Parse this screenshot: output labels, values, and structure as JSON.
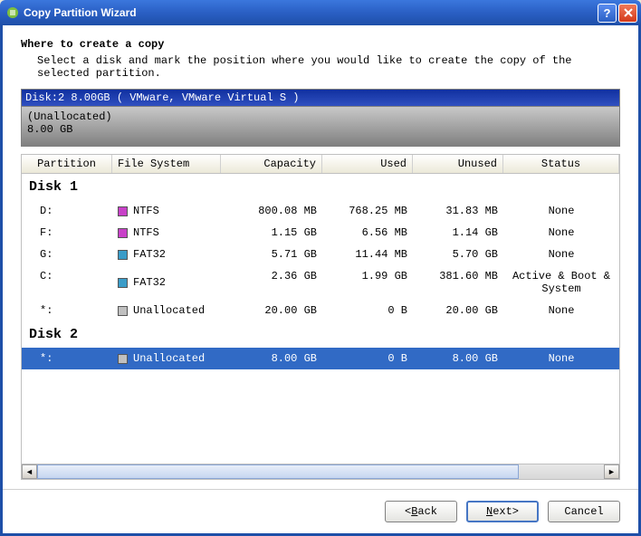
{
  "window": {
    "title": "Copy Partition Wizard"
  },
  "header": {
    "title": "Where to create a copy",
    "subtitle": "Select a disk and mark the position where you would like to create the copy of the selected partition."
  },
  "disk_banner": "Disk:2 8.00GB  ( VMware, VMware Virtual S )",
  "disk_graphic": {
    "label": "(Unallocated)",
    "size": "8.00 GB"
  },
  "columns": {
    "partition": "Partition",
    "filesystem": "File System",
    "capacity": "Capacity",
    "used": "Used",
    "unused": "Unused",
    "status": "Status"
  },
  "swatch_colors": {
    "NTFS": "#c841c8",
    "FAT32": "#3a9cc8",
    "Unallocated": "#c0c0c0"
  },
  "groups": [
    {
      "name": "Disk 1",
      "rows": [
        {
          "partition": "D:",
          "fs": "NTFS",
          "capacity": "800.08 MB",
          "used": "768.25 MB",
          "unused": "31.83 MB",
          "status": "None",
          "selected": false
        },
        {
          "partition": "F:",
          "fs": "NTFS",
          "capacity": "1.15 GB",
          "used": "6.56 MB",
          "unused": "1.14 GB",
          "status": "None",
          "selected": false
        },
        {
          "partition": "G:",
          "fs": "FAT32",
          "capacity": "5.71 GB",
          "used": "11.44 MB",
          "unused": "5.70 GB",
          "status": "None",
          "selected": false
        },
        {
          "partition": "C:",
          "fs": "FAT32",
          "capacity": "2.36 GB",
          "used": "1.99 GB",
          "unused": "381.60 MB",
          "status": "Active & Boot & System",
          "selected": false
        },
        {
          "partition": "*:",
          "fs": "Unallocated",
          "capacity": "20.00 GB",
          "used": "0 B",
          "unused": "20.00 GB",
          "status": "None",
          "selected": false
        }
      ]
    },
    {
      "name": "Disk 2",
      "rows": [
        {
          "partition": "*:",
          "fs": "Unallocated",
          "capacity": "8.00 GB",
          "used": "0 B",
          "unused": "8.00 GB",
          "status": "None",
          "selected": true
        }
      ]
    }
  ],
  "buttons": {
    "back": "Back",
    "next": "Next",
    "cancel": "Cancel"
  }
}
